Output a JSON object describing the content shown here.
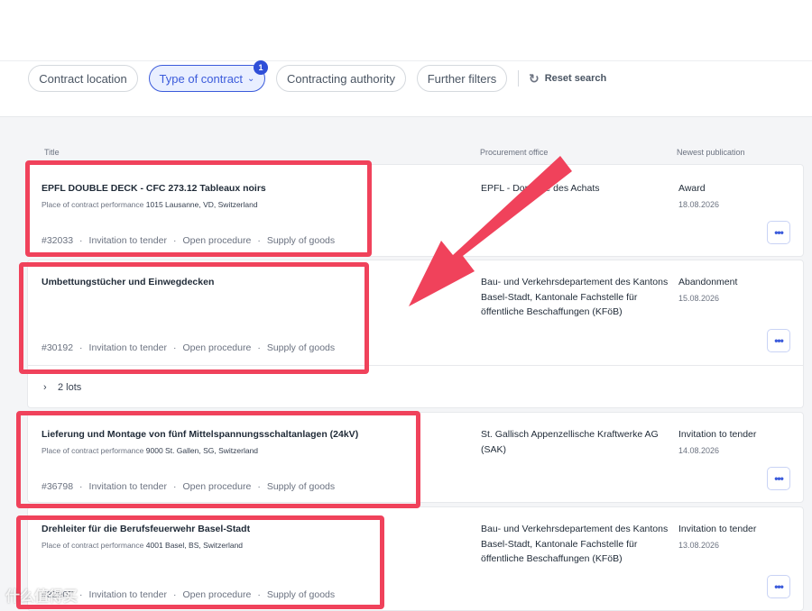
{
  "filters": {
    "contract_location": "Contract location",
    "type_of_contract": "Type of contract",
    "type_of_contract_badge": "1",
    "contracting_authority": "Contracting authority",
    "further_filters": "Further filters",
    "reset_search": "Reset search"
  },
  "columns": {
    "title": "Title",
    "procurement_office": "Procurement office",
    "newest_publication": "Newest publication"
  },
  "results": [
    {
      "title": "EPFL DOUBLE DECK - CFC 273.12 Tableaux noirs",
      "place_label": "Place of contract performance",
      "place_value": "1015 Lausanne, VD, Switzerland",
      "id": "#32033",
      "stage": "Invitation to tender",
      "procedure": "Open procedure",
      "category": "Supply of goods",
      "office": "EPFL - Domaine des Achats",
      "publication": "Award",
      "date": "18.08.2026"
    },
    {
      "title": "Umbettungstücher und Einwegdecken",
      "id": "#30192",
      "stage": "Invitation to tender",
      "procedure": "Open procedure",
      "category": "Supply of goods",
      "office": "Bau- und Verkehrsdepartement des Kantons Basel-Stadt, Kantonale Fachstelle für öffentliche Beschaffungen (KFöB)",
      "publication": "Abandonment",
      "date": "15.08.2026",
      "lots": "2 lots"
    },
    {
      "title": "Lieferung und Montage von fünf Mittelspannungsschaltanlagen (24kV)",
      "place_label": "Place of contract performance",
      "place_value": "9000 St. Gallen, SG, Switzerland",
      "id": "#36798",
      "stage": "Invitation to tender",
      "procedure": "Open procedure",
      "category": "Supply of goods",
      "office": "St. Gallisch Appenzellische Kraftwerke AG (SAK)",
      "publication": "Invitation to tender",
      "date": "14.08.2026"
    },
    {
      "title": "Drehleiter für die Berufsfeuerwehr Basel-Stadt",
      "place_label": "Place of contract performance",
      "place_value": "4001 Basel, BS, Switzerland",
      "id": "#32907",
      "stage": "Invitation to tender",
      "procedure": "Open procedure",
      "category": "Supply of goods",
      "office": "Bau- und Verkehrsdepartement des Kantons Basel-Stadt, Kantonale Fachstelle für öffentliche Beschaffungen (KFöB)",
      "publication": "Invitation to tender",
      "date": "13.08.2026"
    }
  ],
  "more_button_glyph": "•••",
  "meta_separator": "·",
  "watermark": "什么值得买",
  "colors": {
    "accent": "#3b5bdb",
    "highlight": "#f0425b"
  }
}
